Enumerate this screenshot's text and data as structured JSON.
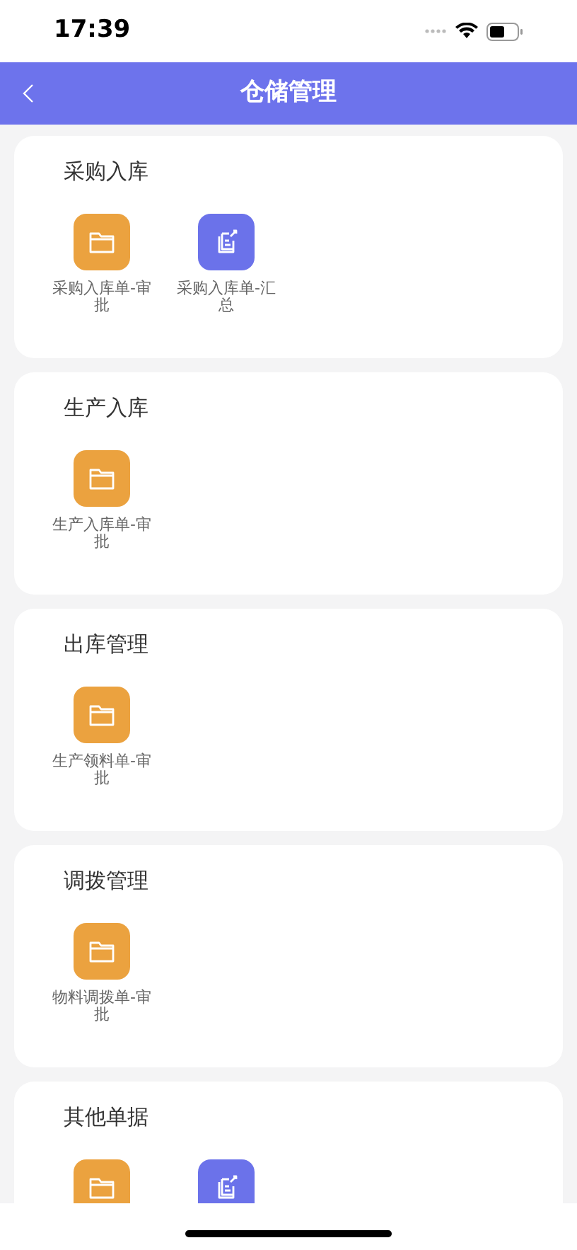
{
  "status_bar": {
    "time": "17:39"
  },
  "header": {
    "title": "仓储管理"
  },
  "sections": [
    {
      "title": "采购入库",
      "items": [
        {
          "kind": "folder",
          "label": "采购入库单-审批"
        },
        {
          "kind": "edit",
          "label": "采购入库单-汇总"
        }
      ]
    },
    {
      "title": "生产入库",
      "items": [
        {
          "kind": "folder",
          "label": "生产入库单-审批"
        }
      ]
    },
    {
      "title": "出库管理",
      "items": [
        {
          "kind": "folder",
          "label": "生产领料单-审批"
        }
      ]
    },
    {
      "title": "调拨管理",
      "items": [
        {
          "kind": "folder",
          "label": "物料调拨单-审批"
        }
      ]
    },
    {
      "title": "其他单据",
      "items": [
        {
          "kind": "folder"
        },
        {
          "kind": "edit"
        }
      ]
    }
  ]
}
